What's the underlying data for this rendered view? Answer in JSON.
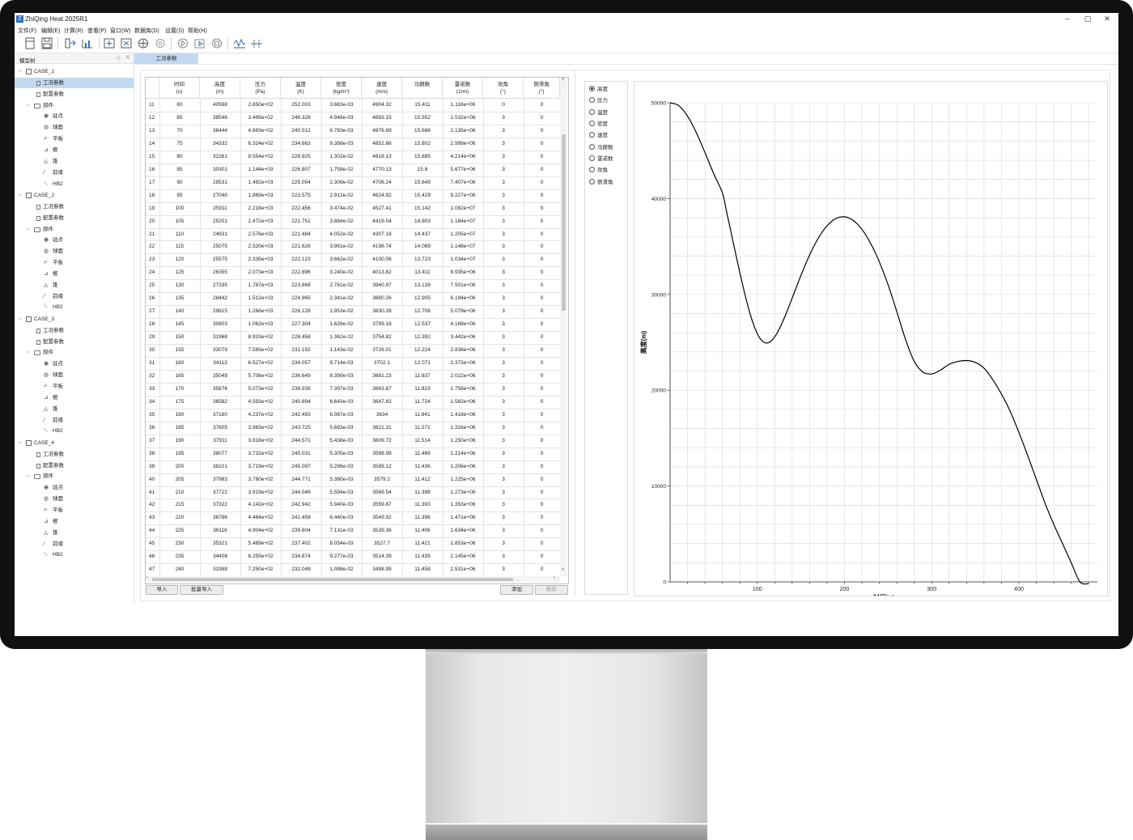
{
  "window": {
    "title": "ZhiQing Heat 2025R1",
    "minimize": "–",
    "maximize": "▢",
    "close": "✕"
  },
  "menu": [
    "文件(F)",
    "编辑(E)",
    "计算(R)",
    "查看(P)",
    "窗口(W)",
    "数据库(D)",
    "设置(S)",
    "帮助(H)"
  ],
  "tree": {
    "title": "模型树",
    "cases": [
      {
        "name": "CASE_1",
        "items": [
          "工况参数",
          "配置参数"
        ],
        "group": "部件",
        "parts": [
          "驻点",
          "球面",
          "平板",
          "楔",
          "锥",
          "前缘",
          "HB2"
        ]
      },
      {
        "name": "CASE_2",
        "items": [
          "工况参数",
          "配置参数"
        ],
        "group": "部件",
        "parts": [
          "驻点",
          "球面",
          "平板",
          "楔",
          "锥",
          "前缘",
          "HB2"
        ]
      },
      {
        "name": "CASE_3",
        "items": [
          "工况参数",
          "配置参数"
        ],
        "group": "部件",
        "parts": [
          "驻点",
          "球面",
          "平板",
          "楔",
          "锥",
          "前缘",
          "HB2"
        ]
      },
      {
        "name": "CASE_4",
        "items": [
          "工况参数",
          "配置参数"
        ],
        "group": "部件",
        "parts": [
          "驻点",
          "球面",
          "平板",
          "楔",
          "锥",
          "前缘",
          "HB2"
        ]
      }
    ]
  },
  "tab": {
    "label": "工况参数"
  },
  "table": {
    "headers": [
      {
        "l1": "",
        "l2": ""
      },
      {
        "l1": "时间",
        "l2": "(s)"
      },
      {
        "l1": "高度",
        "l2": "(m)"
      },
      {
        "l1": "压力",
        "l2": "(Pa)"
      },
      {
        "l1": "温度",
        "l2": "(K)"
      },
      {
        "l1": "密度",
        "l2": "(kg/m³)"
      },
      {
        "l1": "速度",
        "l2": "(m/s)"
      },
      {
        "l1": "马赫数",
        "l2": ""
      },
      {
        "l1": "雷诺数",
        "l2": "(1/m)"
      },
      {
        "l1": "攻角",
        "l2": "(°)"
      },
      {
        "l1": "侧滑角",
        "l2": "(°)"
      }
    ],
    "rows": [
      [
        "11",
        "60",
        "40598",
        "2.650e+02",
        "252.003",
        "3.663e-03",
        "4904.32",
        "15.411",
        "1.116e+06",
        "0",
        "0"
      ],
      [
        "12",
        "65",
        "38546",
        "3.499e+02",
        "246.328",
        "4.948e-03",
        "4893.15",
        "15.552",
        "1.532e+06",
        "3",
        "0"
      ],
      [
        "13",
        "70",
        "36444",
        "4.683e+02",
        "240.512",
        "6.783e-03",
        "4876.69",
        "15.686",
        "2.135e+06",
        "3",
        "0"
      ],
      [
        "14",
        "75",
        "34332",
        "6.324e+02",
        "234.663",
        "9.388e-03",
        "4852.66",
        "15.802",
        "2.999e+06",
        "3",
        "0"
      ],
      [
        "15",
        "80",
        "32261",
        "8.554e+02",
        "228.925",
        "1.302e-02",
        "4818.13",
        "15.885",
        "4.214e+06",
        "3",
        "0"
      ],
      [
        "16",
        "85",
        "30301",
        "1.144e+03",
        "226.807",
        "1.758e-02",
        "4770.13",
        "15.8",
        "5.677e+06",
        "3",
        "0"
      ],
      [
        "17",
        "90",
        "28531",
        "1.492e+03",
        "225.054",
        "2.309e-02",
        "4706.24",
        "15.649",
        "7.407e+06",
        "3",
        "0"
      ],
      [
        "18",
        "95",
        "27040",
        "1.869e+03",
        "223.575",
        "2.912e-02",
        "4624.82",
        "15.429",
        "9.227e+06",
        "3",
        "0"
      ],
      [
        "19",
        "100",
        "25911",
        "2.218e+03",
        "222.456",
        "3.474e-02",
        "4527.41",
        "15.142",
        "1.082e+07",
        "3",
        "0"
      ],
      [
        "20",
        "105",
        "25201",
        "2.472e+03",
        "221.751",
        "3.884e-02",
        "4419.04",
        "14.803",
        "1.184e+07",
        "3",
        "0"
      ],
      [
        "21",
        "110",
        "24931",
        "2.576e+03",
        "221.484",
        "4.052e-02",
        "4307.18",
        "14.437",
        "1.205e+07",
        "3",
        "0"
      ],
      [
        "22",
        "115",
        "25075",
        "2.520e+03",
        "221.626",
        "3.961e-02",
        "4198.74",
        "14.069",
        "1.148e+07",
        "3",
        "0"
      ],
      [
        "23",
        "120",
        "25575",
        "2.335e+03",
        "222.123",
        "3.662e-02",
        "4100.06",
        "13.723",
        "1.034e+07",
        "3",
        "0"
      ],
      [
        "24",
        "125",
        "26355",
        "2.073e+03",
        "222.896",
        "3.240e-02",
        "4013.82",
        "13.411",
        "8.935e+06",
        "3",
        "0"
      ],
      [
        "25",
        "130",
        "27335",
        "1.787e+03",
        "223.868",
        "2.781e-02",
        "3940.97",
        "13.139",
        "7.501e+06",
        "3",
        "0"
      ],
      [
        "26",
        "135",
        "28442",
        "1.512e+03",
        "224.965",
        "2.341e-02",
        "3880.26",
        "12.905",
        "6.194e+06",
        "3",
        "0"
      ],
      [
        "27",
        "140",
        "29615",
        "1.268e+03",
        "226.128",
        "1.953e-02",
        "3830.28",
        "12.706",
        "5.079e+06",
        "3",
        "0"
      ],
      [
        "28",
        "145",
        "30803",
        "1.062e+03",
        "227.304",
        "1.628e-02",
        "3789.16",
        "12.537",
        "4.168e+06",
        "3",
        "0"
      ],
      [
        "29",
        "150",
        "31968",
        "8.933e+02",
        "228.458",
        "1.362e-02",
        "3754.82",
        "12.392",
        "3.442e+06",
        "3",
        "0"
      ],
      [
        "30",
        "155",
        "33079",
        "7.585e+02",
        "231.192",
        "1.143e-02",
        "3726.01",
        "12.224",
        "2.838e+06",
        "3",
        "0"
      ],
      [
        "31",
        "160",
        "34113",
        "6.527e+02",
        "234.057",
        "9.714e-03",
        "3702.1",
        "12.071",
        "2.373e+06",
        "3",
        "0"
      ],
      [
        "32",
        "165",
        "35049",
        "5.706e+02",
        "236.649",
        "8.399e-03",
        "3681.23",
        "11.937",
        "2.022e+06",
        "3",
        "0"
      ],
      [
        "33",
        "170",
        "35876",
        "5.073e+02",
        "238.939",
        "7.397e-03",
        "3663.67",
        "11.823",
        "1.758e+06",
        "3",
        "0"
      ],
      [
        "34",
        "175",
        "36582",
        "4.593e+02",
        "240.894",
        "6.643e-03",
        "3647.82",
        "11.724",
        "1.562e+06",
        "3",
        "0"
      ],
      [
        "35",
        "180",
        "37160",
        "4.237e+02",
        "242.493",
        "6.087e-03",
        "3634",
        "11.641",
        "1.418e+06",
        "3",
        "0"
      ],
      [
        "36",
        "185",
        "37605",
        "3.983e+02",
        "243.725",
        "5.693e-03",
        "3621.31",
        "11.571",
        "1.316e+06",
        "3",
        "0"
      ],
      [
        "37",
        "190",
        "37911",
        "3.818e+02",
        "244.571",
        "5.438e-03",
        "3609.72",
        "11.514",
        "1.250e+06",
        "3",
        "0"
      ],
      [
        "38",
        "195",
        "38077",
        "3.732e+02",
        "245.031",
        "5.305e-03",
        "3598.99",
        "11.469",
        "1.214e+06",
        "3",
        "0"
      ],
      [
        "39",
        "200",
        "38101",
        "3.719e+02",
        "245.097",
        "5.286e-03",
        "3589.12",
        "11.436",
        "1.206e+06",
        "3",
        "0"
      ],
      [
        "40",
        "205",
        "37983",
        "3.780e+02",
        "244.771",
        "5.380e-03",
        "3579.2",
        "11.412",
        "1.225e+06",
        "3",
        "0"
      ],
      [
        "41",
        "210",
        "37722",
        "3.919e+02",
        "244.049",
        "5.594e-03",
        "3569.54",
        "11.398",
        "1.273e+06",
        "3",
        "0"
      ],
      [
        "42",
        "215",
        "37322",
        "4.142e+02",
        "242.942",
        "5.940e-03",
        "3559.87",
        "11.393",
        "1.353e+06",
        "3",
        "0"
      ],
      [
        "43",
        "220",
        "36786",
        "4.464e+02",
        "241.458",
        "6.440e-03",
        "3549.92",
        "11.396",
        "1.471e+06",
        "3",
        "0"
      ],
      [
        "44",
        "225",
        "36116",
        "4.904e+02",
        "239.604",
        "7.131e-03",
        "3539.36",
        "11.406",
        "1.634e+06",
        "3",
        "0"
      ],
      [
        "45",
        "230",
        "35321",
        "5.489e+02",
        "237.402",
        "8.054e-03",
        "3527.7",
        "11.421",
        "1.853e+06",
        "3",
        "0"
      ],
      [
        "46",
        "235",
        "34408",
        "6.255e+02",
        "234.874",
        "9.277e-03",
        "3514.39",
        "11.439",
        "2.145e+06",
        "3",
        "0"
      ],
      [
        "47",
        "240",
        "33388",
        "7.250e+02",
        "232.048",
        "1.088e-02",
        "3498.99",
        "11.458",
        "2.531e+06",
        "3",
        "0"
      ]
    ]
  },
  "buttons": {
    "import": "导入",
    "batch_import": "批量导入",
    "add": "添加",
    "delete": "删除"
  },
  "radios": {
    "options": [
      "高度",
      "压力",
      "温度",
      "密度",
      "速度",
      "马赫数",
      "雷诺数",
      "攻角",
      "侧滑角"
    ],
    "selected": "高度"
  },
  "chart_data": {
    "type": "line",
    "xlabel": "时间(s)",
    "ylabel": "高度(m)",
    "xlim": [
      0,
      490
    ],
    "ylim": [
      0,
      50000
    ],
    "x_ticks": [
      100,
      200,
      300,
      400
    ],
    "y_ticks": [
      0,
      10000,
      20000,
      30000,
      40000,
      50000
    ],
    "grid": true,
    "series": [
      {
        "x": [
          0,
          10,
          20,
          30,
          40,
          50,
          60,
          65,
          70,
          75,
          80,
          85,
          90,
          95,
          100,
          105,
          110,
          115,
          120,
          125,
          130,
          135,
          140,
          145,
          150,
          155,
          160,
          165,
          170,
          175,
          180,
          185,
          190,
          195,
          200,
          205,
          210,
          215,
          220,
          225,
          230,
          235,
          240,
          250,
          260,
          270,
          280,
          290,
          300,
          310,
          320,
          330,
          340,
          350,
          360,
          370,
          380,
          390,
          400,
          410,
          420,
          430,
          440,
          450,
          460,
          470,
          480
        ],
        "y": [
          50000,
          49700,
          48600,
          46900,
          44800,
          42600,
          40598,
          38546,
          36444,
          34332,
          32261,
          30301,
          28531,
          27040,
          25911,
          25201,
          24931,
          25075,
          25575,
          26355,
          27335,
          28442,
          29615,
          30803,
          31968,
          33079,
          34113,
          35049,
          35876,
          36582,
          37160,
          37605,
          37911,
          38077,
          38101,
          37983,
          37722,
          37322,
          36786,
          36116,
          35321,
          34408,
          33388,
          31000,
          28200,
          25300,
          23000,
          21900,
          21700,
          22100,
          22700,
          23000,
          23100,
          22900,
          22300,
          21100,
          19600,
          17800,
          15600,
          13200,
          10700,
          8200,
          6000,
          4000,
          2000,
          0,
          -200
        ]
      }
    ]
  },
  "colors": {
    "selection": "#c3d9f1",
    "line": "#000000",
    "grid": "#d8d8d8"
  }
}
